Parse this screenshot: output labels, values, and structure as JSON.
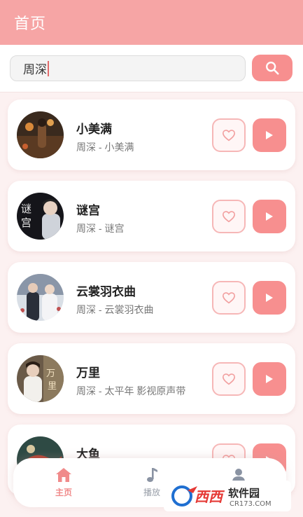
{
  "header": {
    "title": "首页"
  },
  "search": {
    "value": "周深"
  },
  "songs": [
    {
      "title": "小美满",
      "subtitle": "周深 - 小美满"
    },
    {
      "title": "谜宫",
      "subtitle": "周深 - 谜宫"
    },
    {
      "title": "云裳羽衣曲",
      "subtitle": "周深 - 云裳羽衣曲"
    },
    {
      "title": "万里",
      "subtitle": "周深 - 太平年 影视原声带"
    },
    {
      "title": "大鱼",
      "subtitle": ""
    }
  ],
  "nav": {
    "home_label": "主页",
    "play_label": "播放"
  },
  "colors": {
    "accent": "#f78f8f",
    "header": "#f6a5a5",
    "like_border": "#f6b7b7"
  },
  "icons": [
    "search-icon",
    "heart-icon",
    "play-icon",
    "home-icon",
    "music-note-icon",
    "user-icon"
  ]
}
